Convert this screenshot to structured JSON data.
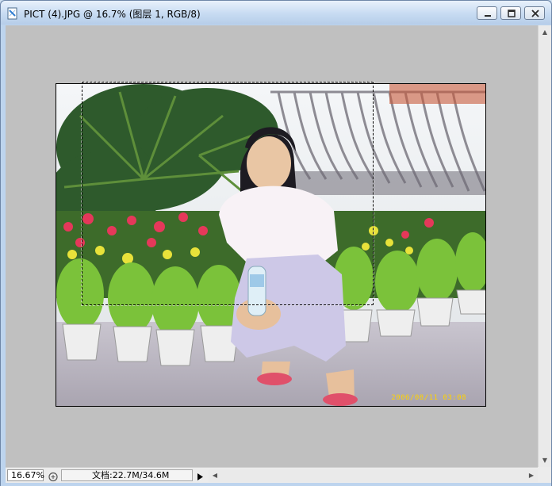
{
  "window": {
    "title": "PICT (4).JPG @ 16.7% (图层 1, RGB/8)",
    "app_icon": "photoshop-document-icon",
    "buttons": {
      "minimize": "minimize-icon",
      "maximize": "maximize-icon",
      "close": "close-icon"
    }
  },
  "photo": {
    "timestamp": "2006/08/11 03:08"
  },
  "statusbar": {
    "zoom": "16.67%",
    "doc_info": "文档:22.7M/34.6M",
    "menu_arrow": "triangle-right-icon"
  },
  "scrollbars": {
    "up_icon": "arrow-up-icon",
    "down_icon": "arrow-down-icon",
    "left_icon": "arrow-left-icon",
    "right_icon": "arrow-right-icon"
  },
  "colors": {
    "canvas_background": "#c0c0c0",
    "titlebar": "#c7dbf2",
    "timestamp": "#ffd200"
  }
}
